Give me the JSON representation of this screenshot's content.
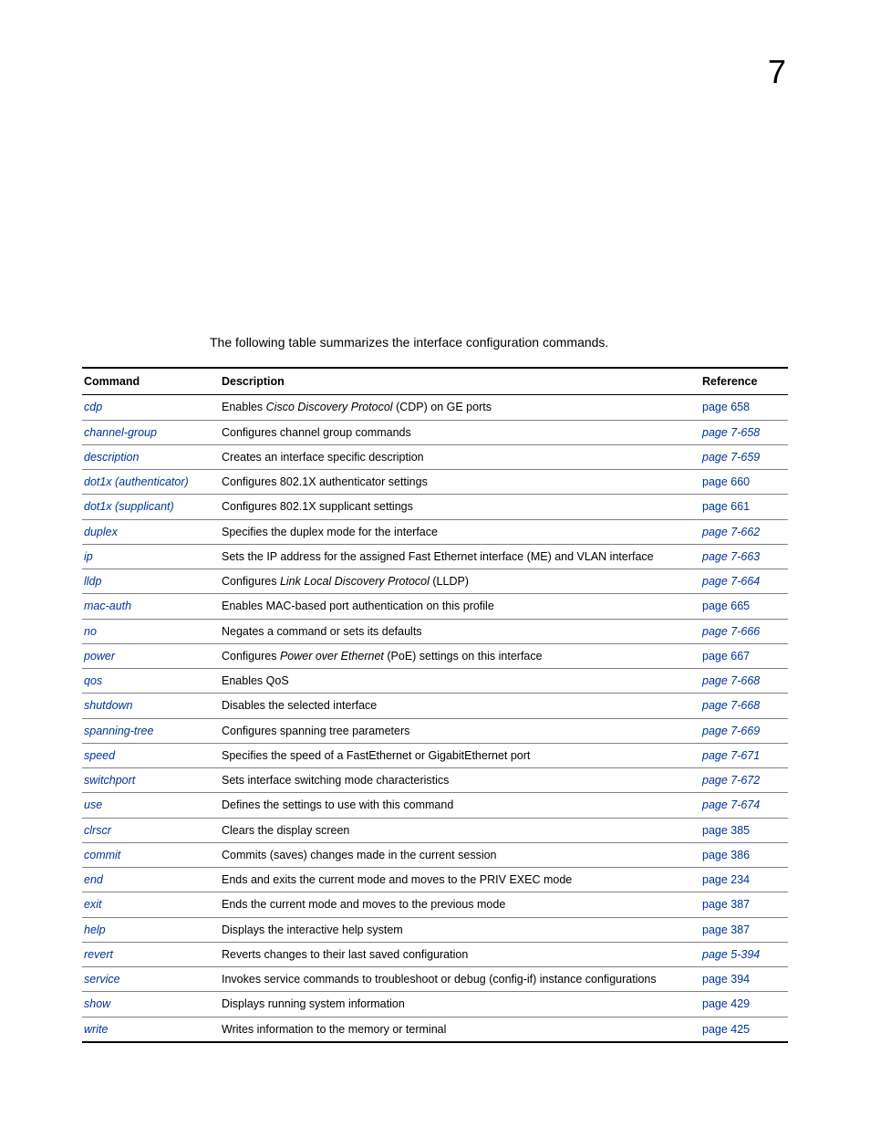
{
  "chapter_number": "7",
  "intro_text": "The following table summarizes the interface configuration commands.",
  "columns": {
    "command": "Command",
    "description": "Description",
    "reference": "Reference"
  },
  "rows": [
    {
      "cmd": "cdp",
      "desc_pre": "Enables ",
      "desc_em": "Cisco Discovery Protocol",
      "desc_post": " (CDP) on GE ports",
      "ref": "page 658",
      "ref_italic": false
    },
    {
      "cmd": "channel-group",
      "desc_pre": "Configures channel group commands",
      "desc_em": "",
      "desc_post": "",
      "ref": "page 7-658",
      "ref_italic": true
    },
    {
      "cmd": "description",
      "desc_pre": "Creates an interface specific description",
      "desc_em": "",
      "desc_post": "",
      "ref": "page 7-659",
      "ref_italic": true
    },
    {
      "cmd": "dot1x (authenticator)",
      "desc_pre": "Configures 802.1X authenticator settings",
      "desc_em": "",
      "desc_post": "",
      "ref": "page 660",
      "ref_italic": false
    },
    {
      "cmd": "dot1x (supplicant)",
      "desc_pre": "Configures 802.1X supplicant settings",
      "desc_em": "",
      "desc_post": "",
      "ref": "page 661",
      "ref_italic": false
    },
    {
      "cmd": "duplex",
      "desc_pre": "Specifies the duplex mode for the interface",
      "desc_em": "",
      "desc_post": "",
      "ref": "page 7-662",
      "ref_italic": true
    },
    {
      "cmd": "ip",
      "desc_pre": "Sets the IP address for the assigned Fast Ethernet interface (ME) and VLAN interface",
      "desc_em": "",
      "desc_post": "",
      "ref": "page 7-663",
      "ref_italic": true
    },
    {
      "cmd": "lldp",
      "desc_pre": "Configures ",
      "desc_em": "Link Local Discovery Protocol",
      "desc_post": " (LLDP)",
      "ref": "page 7-664",
      "ref_italic": true
    },
    {
      "cmd": "mac-auth",
      "desc_pre": "Enables MAC-based port authentication on this profile",
      "desc_em": "",
      "desc_post": "",
      "ref": "page 665",
      "ref_italic": false
    },
    {
      "cmd": "no",
      "desc_pre": "Negates a command or sets its defaults",
      "desc_em": "",
      "desc_post": "",
      "ref": "page 7-666",
      "ref_italic": true
    },
    {
      "cmd": "power",
      "desc_pre": "Configures ",
      "desc_em": "Power over Ethernet",
      "desc_post": " (PoE) settings on this interface",
      "ref": "page 667",
      "ref_italic": false
    },
    {
      "cmd": "qos",
      "desc_pre": "Enables QoS",
      "desc_em": "",
      "desc_post": "",
      "ref": "page 7-668",
      "ref_italic": true
    },
    {
      "cmd": "shutdown",
      "desc_pre": "Disables the selected interface",
      "desc_em": "",
      "desc_post": "",
      "ref": "page 7-668",
      "ref_italic": true
    },
    {
      "cmd": "spanning-tree",
      "desc_pre": "Configures spanning tree parameters",
      "desc_em": "",
      "desc_post": "",
      "ref": "page 7-669",
      "ref_italic": true
    },
    {
      "cmd": "speed",
      "desc_pre": "Specifies the speed of a FastEthernet or GigabitEthernet port",
      "desc_em": "",
      "desc_post": "",
      "ref": "page 7-671",
      "ref_italic": true
    },
    {
      "cmd": "switchport",
      "desc_pre": "Sets interface switching mode characteristics",
      "desc_em": "",
      "desc_post": "",
      "ref": "page 7-672",
      "ref_italic": true
    },
    {
      "cmd": "use",
      "desc_pre": "Defines the settings to use with this command",
      "desc_em": "",
      "desc_post": "",
      "ref": "page 7-674",
      "ref_italic": true
    },
    {
      "cmd": "clrscr",
      "desc_pre": "Clears the display screen",
      "desc_em": "",
      "desc_post": "",
      "ref": "page 385",
      "ref_italic": false
    },
    {
      "cmd": "commit",
      "desc_pre": "Commits (saves) changes made in the current session",
      "desc_em": "",
      "desc_post": "",
      "ref": "page 386",
      "ref_italic": false
    },
    {
      "cmd": "end",
      "desc_pre": "Ends and exits the current mode and moves to the PRIV EXEC mode",
      "desc_em": "",
      "desc_post": "",
      "ref": "page 234",
      "ref_italic": false
    },
    {
      "cmd": "exit",
      "desc_pre": "Ends the current mode and moves to the previous mode",
      "desc_em": "",
      "desc_post": "",
      "ref": "page 387",
      "ref_italic": false
    },
    {
      "cmd": "help",
      "desc_pre": "Displays the interactive help system",
      "desc_em": "",
      "desc_post": "",
      "ref": "page 387",
      "ref_italic": false
    },
    {
      "cmd": "revert",
      "desc_pre": "Reverts changes to their last saved configuration",
      "desc_em": "",
      "desc_post": "",
      "ref": "page 5-394",
      "ref_italic": true
    },
    {
      "cmd": "service",
      "desc_pre": "Invokes service commands to troubleshoot or debug (config-if) instance configurations",
      "desc_em": "",
      "desc_post": "",
      "ref": "page 394",
      "ref_italic": false
    },
    {
      "cmd": "show",
      "desc_pre": "Displays running system information",
      "desc_em": "",
      "desc_post": "",
      "ref": "page 429",
      "ref_italic": false
    },
    {
      "cmd": "write",
      "desc_pre": "Writes information to the memory or terminal",
      "desc_em": "",
      "desc_post": "",
      "ref": "page 425",
      "ref_italic": false
    }
  ]
}
